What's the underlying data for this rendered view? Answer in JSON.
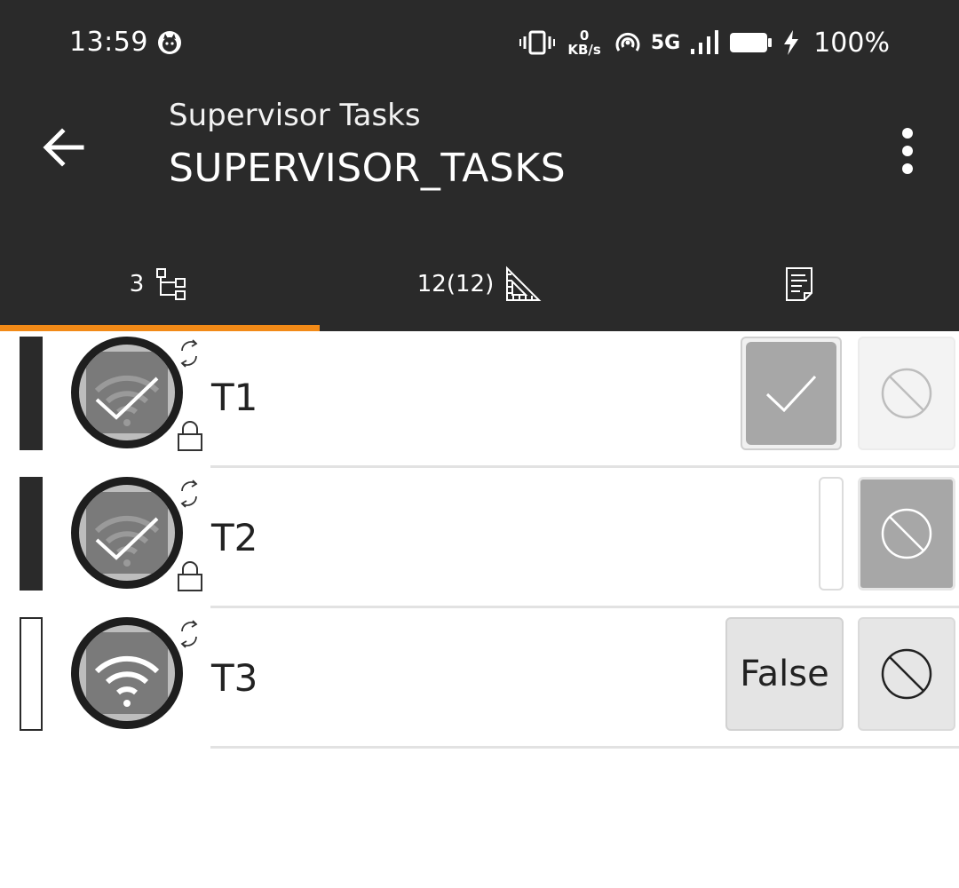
{
  "status_bar": {
    "time": "13:59",
    "net_speed_value": "0",
    "net_speed_unit": "KB/s",
    "network": "5G",
    "battery": "100%",
    "icons": [
      "cat-icon",
      "vibrate-icon",
      "hotspot-icon",
      "signal-icon",
      "battery-icon",
      "charging-icon"
    ]
  },
  "app_bar": {
    "subtitle": "Supervisor Tasks",
    "title": "SUPERVISOR_TASKS",
    "icons": [
      "back-arrow-icon",
      "more-vert-icon"
    ]
  },
  "tabs": [
    {
      "label": "3",
      "icon": "tree-icon",
      "selected": true
    },
    {
      "label": "12(12)",
      "icon": "measure-triangle-icon",
      "selected": false
    },
    {
      "label": "",
      "icon": "document-icon",
      "selected": false
    }
  ],
  "colors": {
    "bar": "#2a2a2a",
    "accent": "#f28a17",
    "divider": "#e2e2e2"
  },
  "tasks": [
    {
      "label": "T1",
      "state": "checked",
      "locked": true,
      "yes_value": "",
      "no_value": ""
    },
    {
      "label": "T2",
      "state": "checked",
      "locked": true,
      "yes_value": "",
      "no_value": ""
    },
    {
      "label": "T3",
      "state": "open",
      "locked": false,
      "yes_value": "False",
      "no_value": ""
    }
  ]
}
